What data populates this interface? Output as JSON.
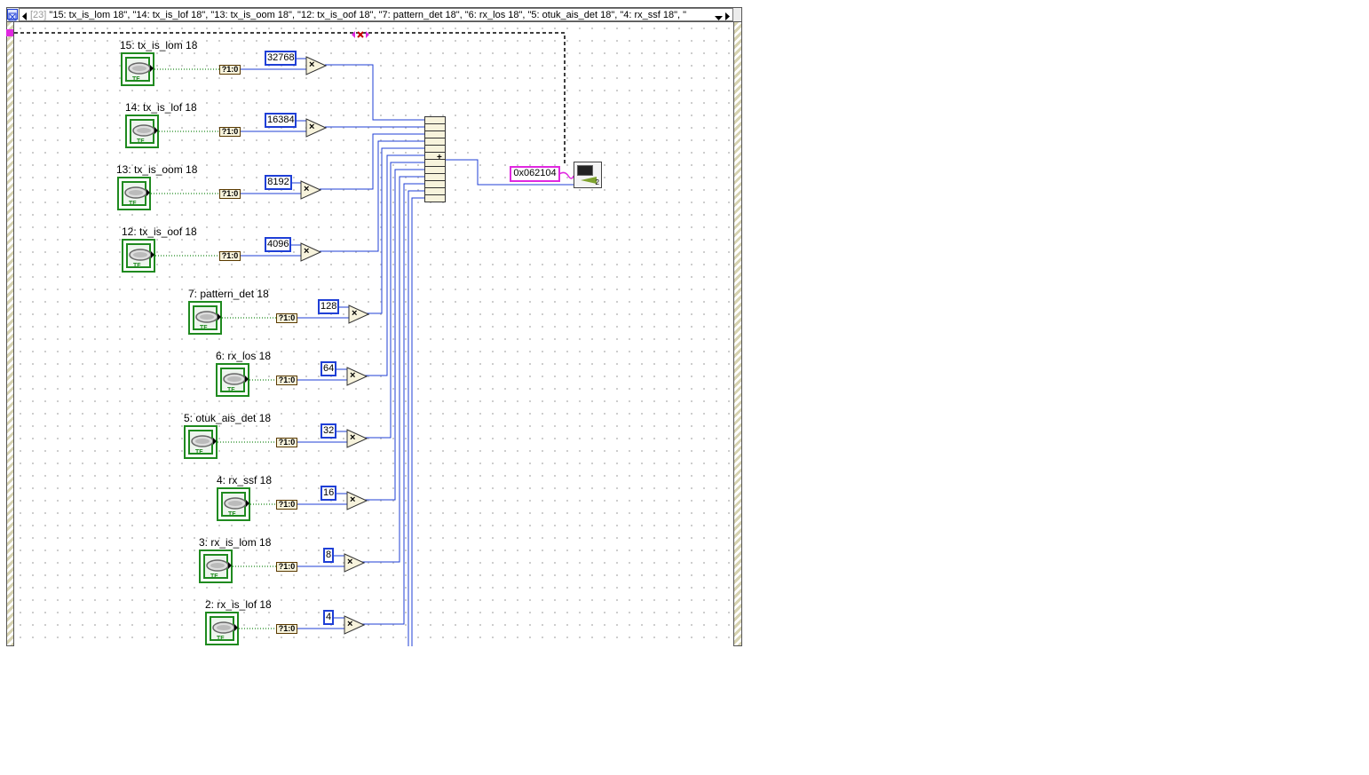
{
  "case_selector": {
    "index": "[23]",
    "text": "\"15: tx_is_lom 18\", \"14: tx_is_lof 18\", \"13: tx_is_oom 18\", \"12: tx_is_oof 18\", \"7: pattern_det 18\", \"6: rx_los 18\", \"5: otuk_ais_det 18\", \"4: rx_ssf 18\", \""
  },
  "conversion_label": "?1:0",
  "terminals": [
    {
      "label": "15: tx_is_lom 18",
      "weight": "32768"
    },
    {
      "label": "14: tx_is_lof 18",
      "weight": "16384"
    },
    {
      "label": "13: tx_is_oom 18",
      "weight": "8192"
    },
    {
      "label": "12: tx_is_oof 18",
      "weight": "4096"
    },
    {
      "label": "7: pattern_det 18",
      "weight": "128"
    },
    {
      "label": "6: rx_los 18",
      "weight": "64"
    },
    {
      "label": "5: otuk_ais_det 18",
      "weight": "32"
    },
    {
      "label": "4: rx_ssf 18",
      "weight": "16"
    },
    {
      "label": "3: rx_is_lom 18",
      "weight": "8"
    },
    {
      "label": "2: rx_is_lof 18",
      "weight": "4"
    }
  ],
  "tf_text": "TF",
  "multiply_symbol": "×",
  "add_symbol": "+",
  "address_constant": "0x062104",
  "subvi_terminal": "2",
  "icons": [
    "case-structure-icon",
    "scroll-left-icon",
    "scroll-right-icon",
    "dropdown-arrow-icon",
    "multiply-icon",
    "compound-add-icon",
    "subvi-icon",
    "boolean-terminal-icon",
    "bool-to-int-icon"
  ],
  "colors": {
    "wire_numeric": "#1f3fd6",
    "boolean_terminal": "#1f8a1f",
    "hex_constant": "#e028e0",
    "error_wire": "#000000"
  }
}
